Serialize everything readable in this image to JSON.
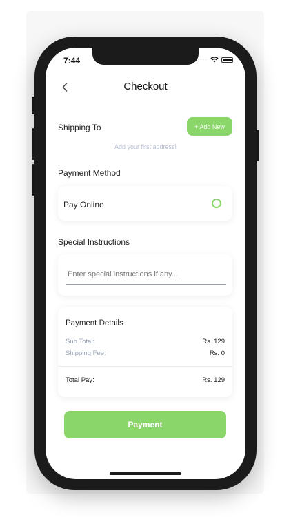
{
  "status_bar": {
    "time": "7:44"
  },
  "header": {
    "back_icon": "chevron-left-icon",
    "title": "Checkout"
  },
  "shipping": {
    "label": "Shipping To",
    "add_button": "+ Add New",
    "empty_hint": "Add your first address!"
  },
  "payment_method": {
    "label": "Payment Method",
    "option_label": "Pay Online",
    "option_selected": false
  },
  "special_instructions": {
    "label": "Special Instructions",
    "placeholder": "Enter special instructions if any..."
  },
  "payment_details": {
    "title": "Payment Details",
    "subtotal_label": "Sub Total:",
    "subtotal_value": "Rs. 129",
    "shipping_label": "Shipping Fee:",
    "shipping_value": "Rs. 0",
    "total_label": "Total Pay:",
    "total_value": "Rs. 129"
  },
  "actions": {
    "payment_button": "Payment"
  },
  "colors": {
    "accent": "#8ad66a",
    "frame": "#1b1b1b",
    "hint": "#b5bdd0"
  }
}
